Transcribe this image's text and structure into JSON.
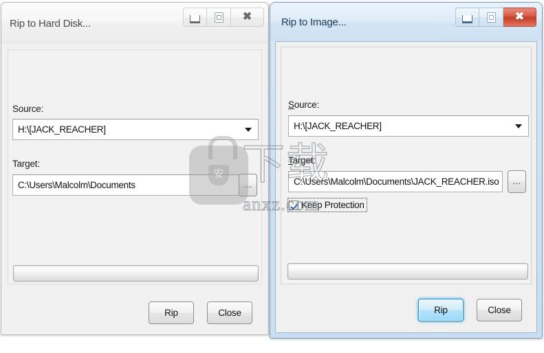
{
  "windows": {
    "left": {
      "title": "Rip to Hard Disk...",
      "state": "inactive",
      "controls": {
        "minimize": "minimize-icon",
        "maximize": "maximize-icon",
        "close": "close-icon"
      },
      "source": {
        "label": "Source:",
        "value": "H:\\[JACK_REACHER]"
      },
      "target": {
        "label": "Target:",
        "value": "C:\\Users\\Malcolm\\Documents",
        "browse_label": "..."
      },
      "buttons": {
        "rip": "Rip",
        "close": "Close"
      },
      "progress_value": 0
    },
    "right": {
      "title": "Rip to Image...",
      "state": "active",
      "controls": {
        "minimize": "minimize-icon",
        "maximize": "maximize-icon",
        "close": "close-icon"
      },
      "source": {
        "label_accesskey": "S",
        "label_rest": "ource:",
        "value": "H:\\[JACK_REACHER]"
      },
      "target": {
        "label_accesskey": "T",
        "label_rest": "arget:",
        "value": "C:\\Users\\Malcolm\\Documents\\JACK_REACHER.iso",
        "browse_label": "..."
      },
      "keep_protection": {
        "label": "Keep Protection",
        "checked": true
      },
      "buttons": {
        "rip": "Rip",
        "close": "Close"
      },
      "progress_value": 0
    }
  },
  "watermark": {
    "shield_char": "安",
    "outline_text": "下载",
    "domain": "anxz.com"
  },
  "colors": {
    "accent_default_button": "#3eaae1",
    "close_button_red": "#c43f2b",
    "active_frame": "#cfe2f3",
    "dialog_face": "#f0f0f0"
  }
}
